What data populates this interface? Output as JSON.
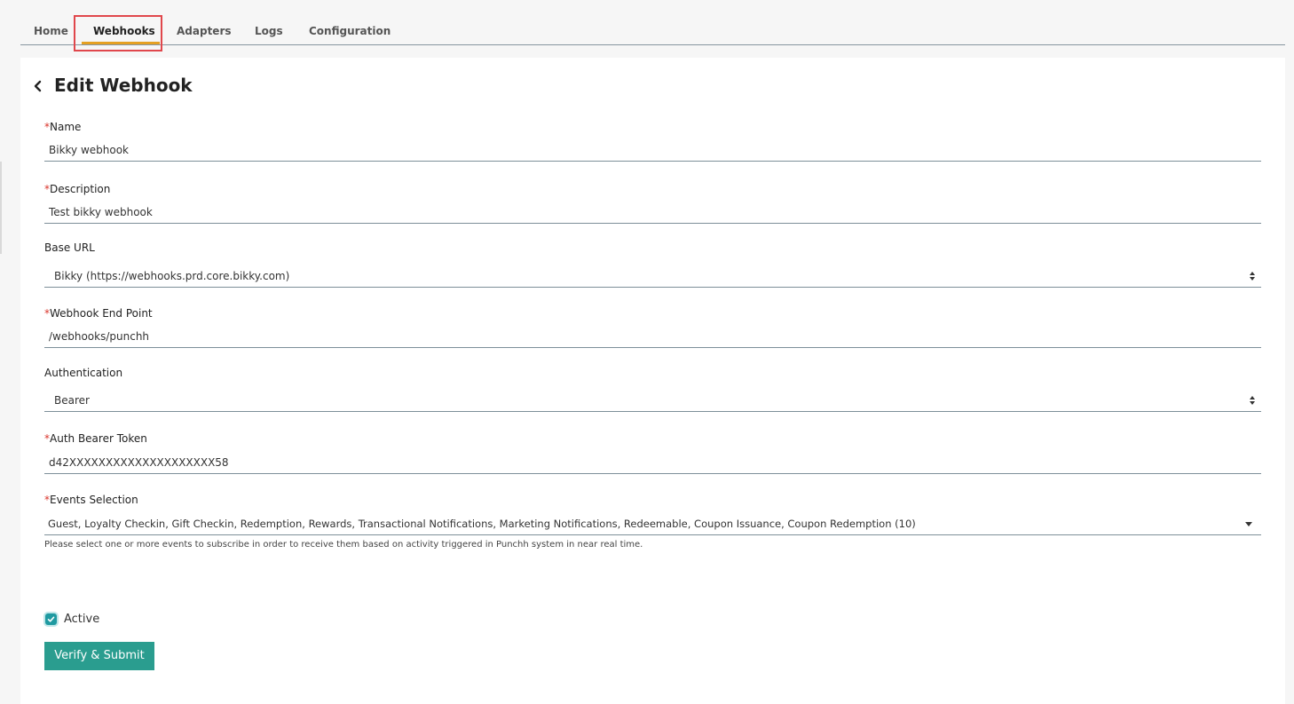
{
  "nav": {
    "tabs": [
      {
        "label": "Home"
      },
      {
        "label": "Webhooks"
      },
      {
        "label": "Adapters"
      },
      {
        "label": "Logs"
      },
      {
        "label": "Configuration"
      }
    ],
    "active_tab": "Webhooks"
  },
  "page": {
    "title": "Edit Webhook",
    "back_icon": "chevron-left-icon"
  },
  "form": {
    "required_marker": "*",
    "name": {
      "label": "Name",
      "value": "Bikky webhook",
      "required": true
    },
    "description": {
      "label": "Description",
      "value": "Test bikky webhook",
      "required": true
    },
    "base_url": {
      "label": "Base URL",
      "value": "Bikky (https://webhooks.prd.core.bikky.com)",
      "required": false
    },
    "endpoint": {
      "label": "Webhook End Point",
      "value": "/webhooks/punchh",
      "required": true
    },
    "authentication": {
      "label": "Authentication",
      "value": "Bearer",
      "required": false
    },
    "bearer_token": {
      "label": "Auth Bearer Token",
      "value": "d42XXXXXXXXXXXXXXXXXXXX58",
      "required": true
    },
    "events": {
      "label": "Events Selection",
      "value": "Guest, Loyalty Checkin, Gift Checkin, Redemption, Rewards, Transactional Notifications, Marketing Notifications, Redeemable, Coupon Issuance, Coupon Redemption (10)",
      "required": true,
      "hint": "Please select one or more events to subscribe in order to receive them based on activity triggered in Punchh system in near real time."
    },
    "active": {
      "label": "Active",
      "checked": true
    },
    "submit_label": "Verify & Submit"
  },
  "colors": {
    "tab_underline": "#e5a022",
    "highlight": "#e0474c",
    "primary_button": "#2a9d8f",
    "checkbox": "#1f9aa1",
    "required": "#d9342b"
  }
}
